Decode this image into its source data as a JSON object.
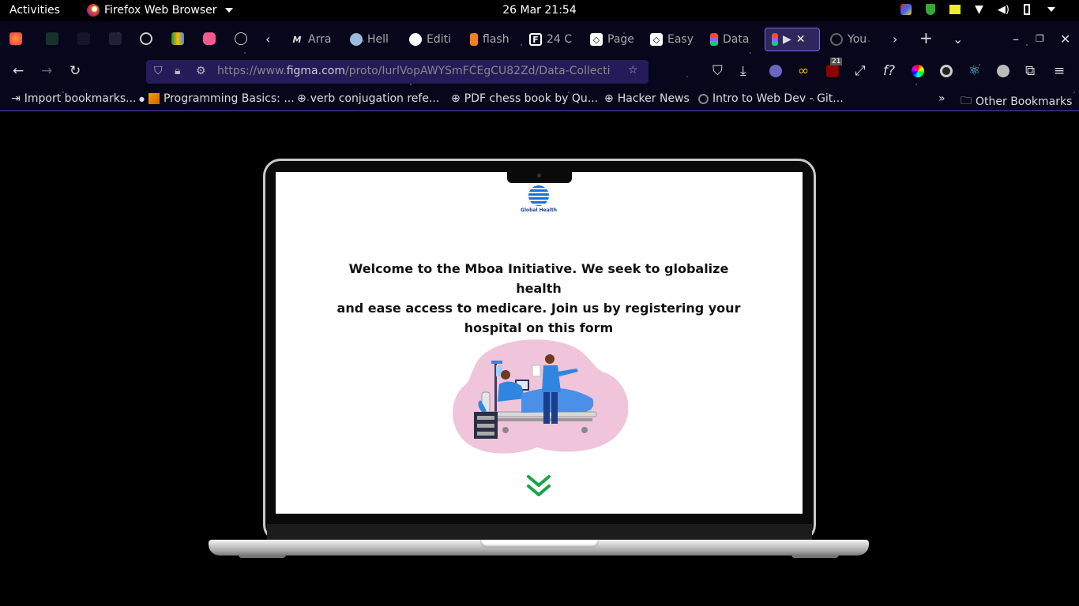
{
  "system": {
    "activities": "Activities",
    "app_name": "Firefox Web Browser",
    "clock": "26 Mar  21:54"
  },
  "tabs": [
    {
      "label": "Arra",
      "icon": "medium-icon"
    },
    {
      "label": "Hell",
      "icon": "cat-icon"
    },
    {
      "label": "Editi",
      "icon": "github-icon"
    },
    {
      "label": "flash",
      "icon": "stackoverflow-icon"
    },
    {
      "label": "24 C",
      "icon": "f-icon"
    },
    {
      "label": "Page",
      "icon": "codepen-icon"
    },
    {
      "label": "Easy",
      "icon": "codepen-icon"
    },
    {
      "label": "Data",
      "icon": "figma-icon"
    },
    {
      "label": "▶",
      "icon": "figma-icon",
      "active": true
    },
    {
      "label": "You",
      "icon": "loading-icon"
    }
  ],
  "navbar": {
    "url_prefix": "https://www.",
    "url_host": "figma.com",
    "url_path": "/proto/IurlVopAWYSmFCEgCU82Zd/Data-Collecti",
    "badge_count": "21"
  },
  "bookmarks": [
    {
      "label": "Import bookmarks...",
      "icon": "import-icon"
    },
    {
      "label": "Programming Basics: ...",
      "icon": "book-icon"
    },
    {
      "label": "verb conjugation refe...",
      "icon": "globe-icon"
    },
    {
      "label": "PDF chess book by Qu...",
      "icon": "globe-icon"
    },
    {
      "label": "Hacker News",
      "icon": "globe-icon"
    },
    {
      "label": "Intro to Web Dev - Git...",
      "icon": "github-icon"
    }
  ],
  "bookmarks_other": "Other Bookmarks",
  "page": {
    "logo_text": "Global Health",
    "welcome_line1": "Welcome to the Mboa  Initiative.  We seek to globalize health",
    "welcome_line2": "and ease access to  medicare. Join us by registering your",
    "welcome_line3": "hospital on this  form"
  },
  "colors": {
    "accent": "#7a6ae0",
    "chevron": "#1aa34a",
    "blob": "#f0c4da",
    "scrubs": "#2f86e0"
  }
}
